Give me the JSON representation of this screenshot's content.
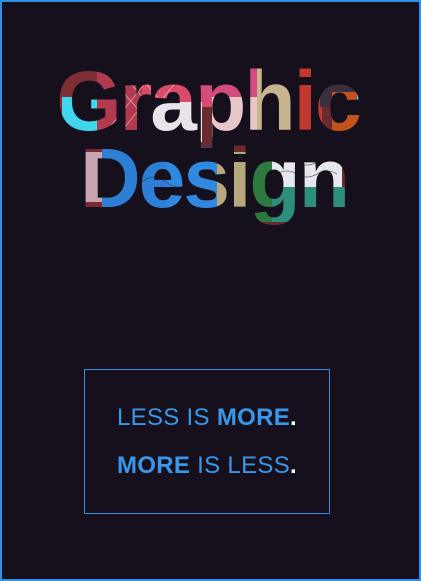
{
  "title": {
    "line1": "Graphic",
    "line2": "Design"
  },
  "motto": {
    "line1": [
      {
        "text": "LESS IS ",
        "style": "light"
      },
      {
        "text": "MORE",
        "style": "bold"
      },
      {
        "text": ".",
        "style": "dot"
      }
    ],
    "line2": [
      {
        "text": "MORE",
        "style": "bold"
      },
      {
        "text": " IS LESS",
        "style": "light"
      },
      {
        "text": ".",
        "style": "dot"
      }
    ]
  },
  "colors": {
    "background": "#15101c",
    "accent": "#2f8fe6",
    "dot": "#ffffff"
  }
}
